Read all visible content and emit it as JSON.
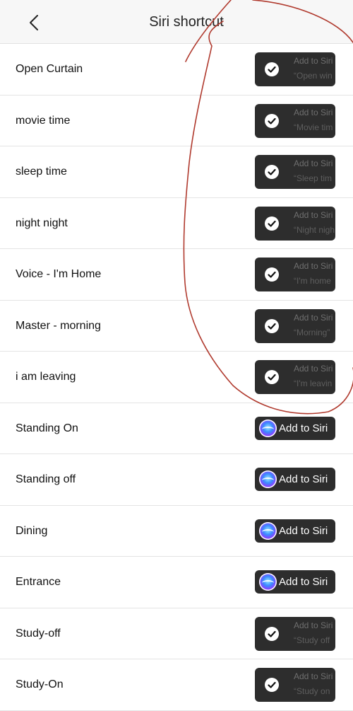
{
  "header": {
    "back_icon": "chevron-left-icon",
    "title": "Siri shortcut"
  },
  "shortcuts": [
    {
      "label": "Open Curtain",
      "status": "added",
      "button_text": "Add to Siri",
      "phrase": "“Open win"
    },
    {
      "label": "movie time",
      "status": "added",
      "button_text": "Add to Siri",
      "phrase": "“Movie tim"
    },
    {
      "label": "sleep time",
      "status": "added",
      "button_text": "Add to Siri",
      "phrase": "“Sleep tim"
    },
    {
      "label": "night night",
      "status": "added",
      "button_text": "Add to Siri",
      "phrase": "“Night nigh"
    },
    {
      "label": "Voice - I'm Home",
      "status": "added",
      "button_text": "Add to Siri",
      "phrase": "“I'm home"
    },
    {
      "label": "Master - morning",
      "status": "added",
      "button_text": "Add to Siri",
      "phrase": "“Morning”"
    },
    {
      "label": "i am leaving",
      "status": "added",
      "button_text": "Add to Siri",
      "phrase": "“I'm leavin"
    },
    {
      "label": "Standing On",
      "status": "not_added",
      "button_text": "Add to Siri"
    },
    {
      "label": "Standing off",
      "status": "not_added",
      "button_text": "Add to Siri"
    },
    {
      "label": "Dining",
      "status": "not_added",
      "button_text": "Add to Siri"
    },
    {
      "label": "Entrance",
      "status": "not_added",
      "button_text": "Add to Siri"
    },
    {
      "label": "Study-off",
      "status": "added",
      "button_text": "Add to Siri",
      "phrase": "“Study off"
    },
    {
      "label": "Study-On",
      "status": "added",
      "button_text": "Add to Siri",
      "phrase": "“Study on"
    }
  ],
  "colors": {
    "button_bg": "#2d2d2d",
    "annotation": "#b03a2e",
    "navbar_bg": "#f7f7f7"
  },
  "annotation": "freehand-circle-around-added-shortcuts"
}
